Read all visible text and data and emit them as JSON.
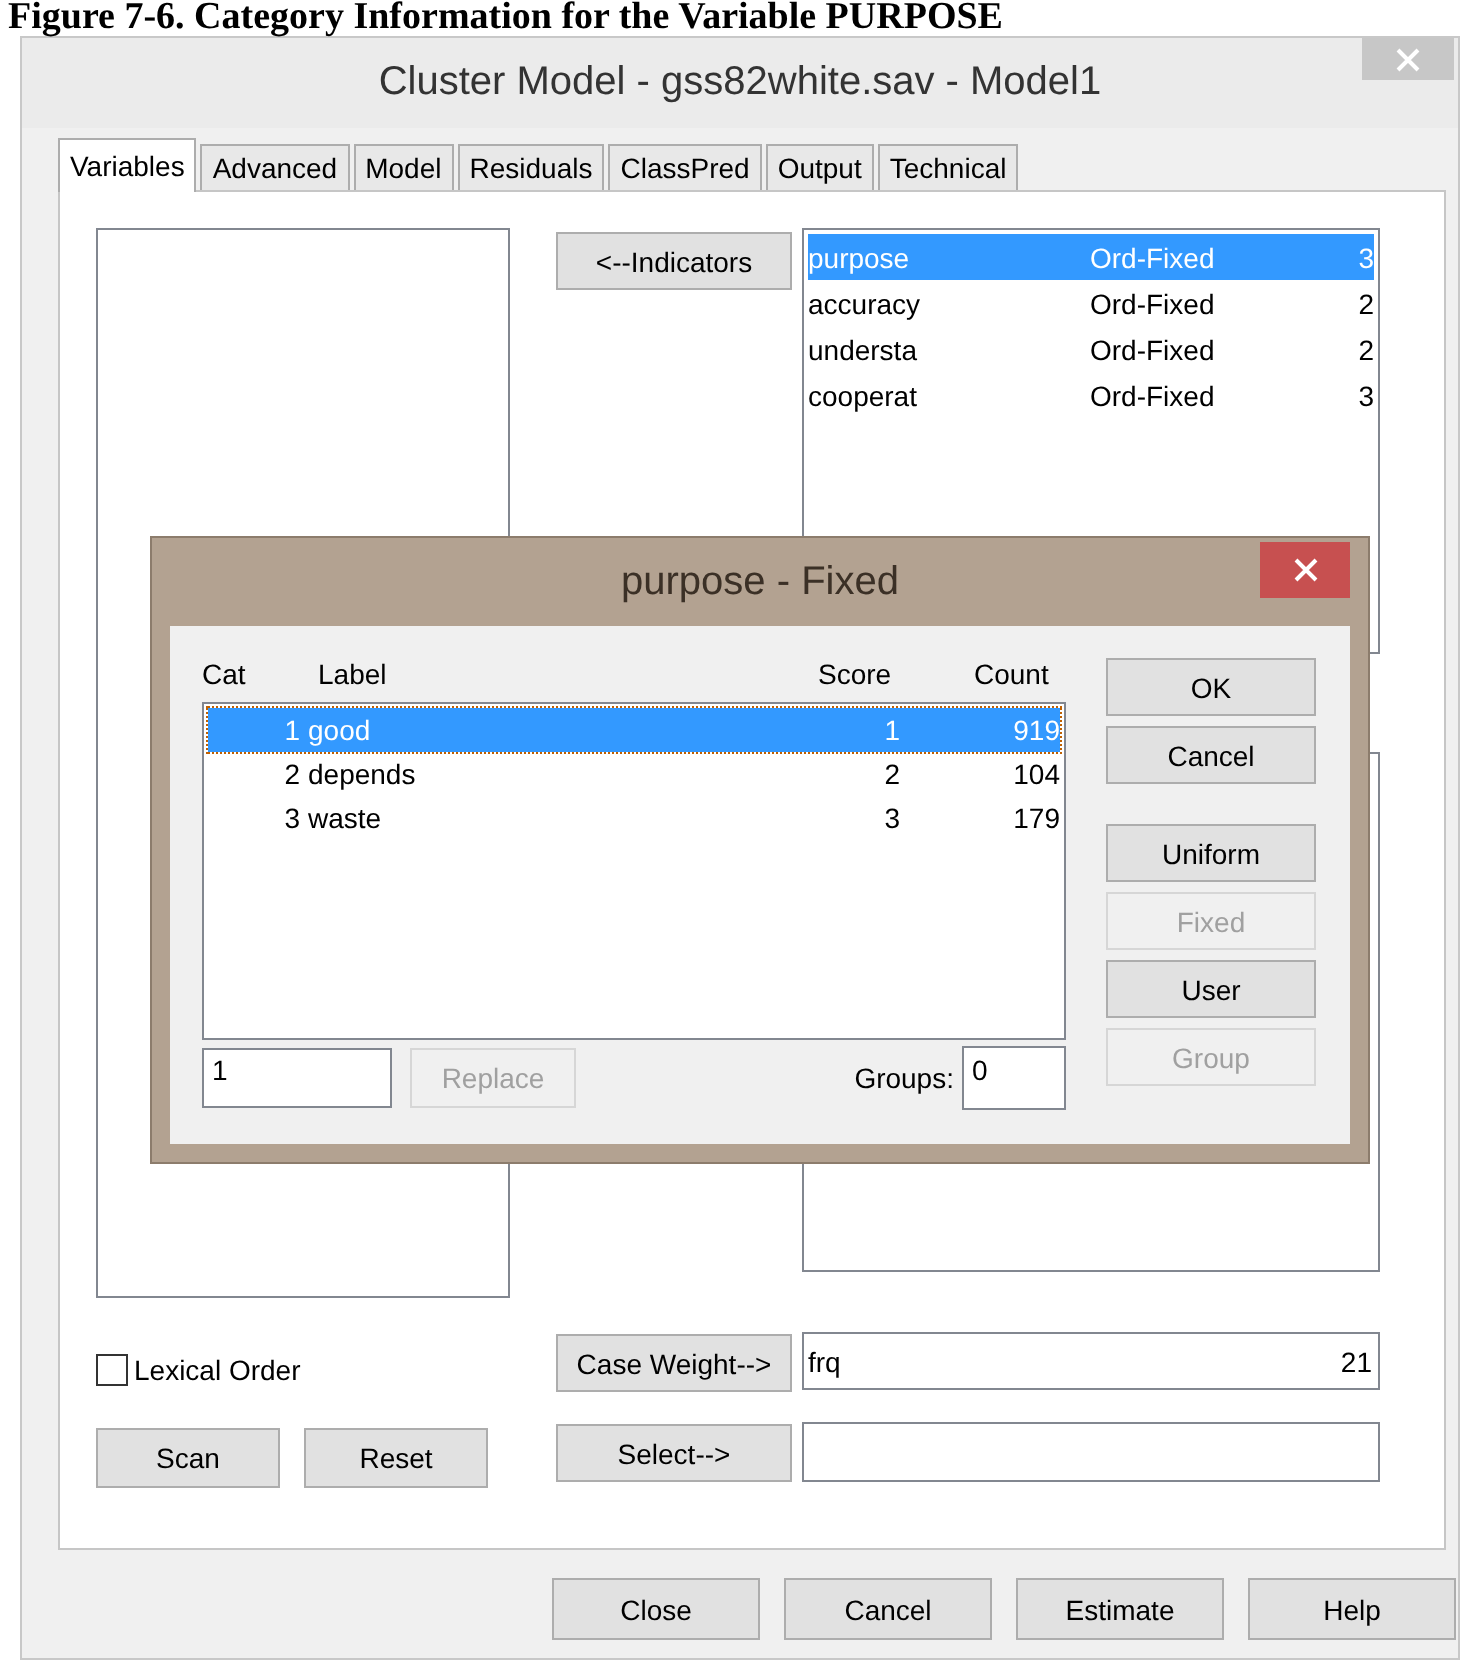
{
  "caption": "Figure 7-6. Category Information for the Variable PURPOSE",
  "window": {
    "title": "Cluster Model - gss82white.sav - Model1"
  },
  "tabs": [
    {
      "label": "Variables",
      "selected": true
    },
    {
      "label": "Advanced",
      "selected": false
    },
    {
      "label": "Model",
      "selected": false
    },
    {
      "label": "Residuals",
      "selected": false
    },
    {
      "label": "ClassPred",
      "selected": false
    },
    {
      "label": "Output",
      "selected": false
    },
    {
      "label": "Technical",
      "selected": false
    }
  ],
  "indicators_button": "<--Indicators",
  "indicators": [
    {
      "name": "purpose",
      "type": "Ord-Fixed",
      "categories": "3",
      "selected": true
    },
    {
      "name": "accuracy",
      "type": "Ord-Fixed",
      "categories": "2",
      "selected": false
    },
    {
      "name": "understa",
      "type": "Ord-Fixed",
      "categories": "2",
      "selected": false
    },
    {
      "name": "cooperat",
      "type": "Ord-Fixed",
      "categories": "3",
      "selected": false
    }
  ],
  "lexical_order": {
    "label": "Lexical Order",
    "checked": false
  },
  "scan_button": "Scan",
  "reset_button": "Reset",
  "case_weight": {
    "button": "Case Weight-->",
    "variable": "frq",
    "number": "21"
  },
  "select_button": "Select-->",
  "footer_buttons": [
    "Close",
    "Cancel",
    "Estimate",
    "Help"
  ],
  "dialog": {
    "title": "purpose - Fixed",
    "columns": [
      "Cat",
      "Label",
      "Score",
      "Count"
    ],
    "rows": [
      {
        "cat": "1",
        "label": "good",
        "score": "1",
        "count": "919",
        "selected": true
      },
      {
        "cat": "2",
        "label": "depends",
        "score": "2",
        "count": "104",
        "selected": false
      },
      {
        "cat": "3",
        "label": "waste",
        "score": "3",
        "count": "179",
        "selected": false
      }
    ],
    "value_field": "1",
    "replace_button": {
      "label": "Replace",
      "disabled": true
    },
    "groups_label": "Groups:",
    "groups_value": "0",
    "buttons": [
      {
        "label": "OK",
        "disabled": false
      },
      {
        "label": "Cancel",
        "disabled": false
      }
    ],
    "score_buttons": [
      {
        "label": "Uniform",
        "disabled": false
      },
      {
        "label": "Fixed",
        "disabled": true
      },
      {
        "label": "User",
        "disabled": false
      },
      {
        "label": "Group",
        "disabled": true
      }
    ]
  }
}
